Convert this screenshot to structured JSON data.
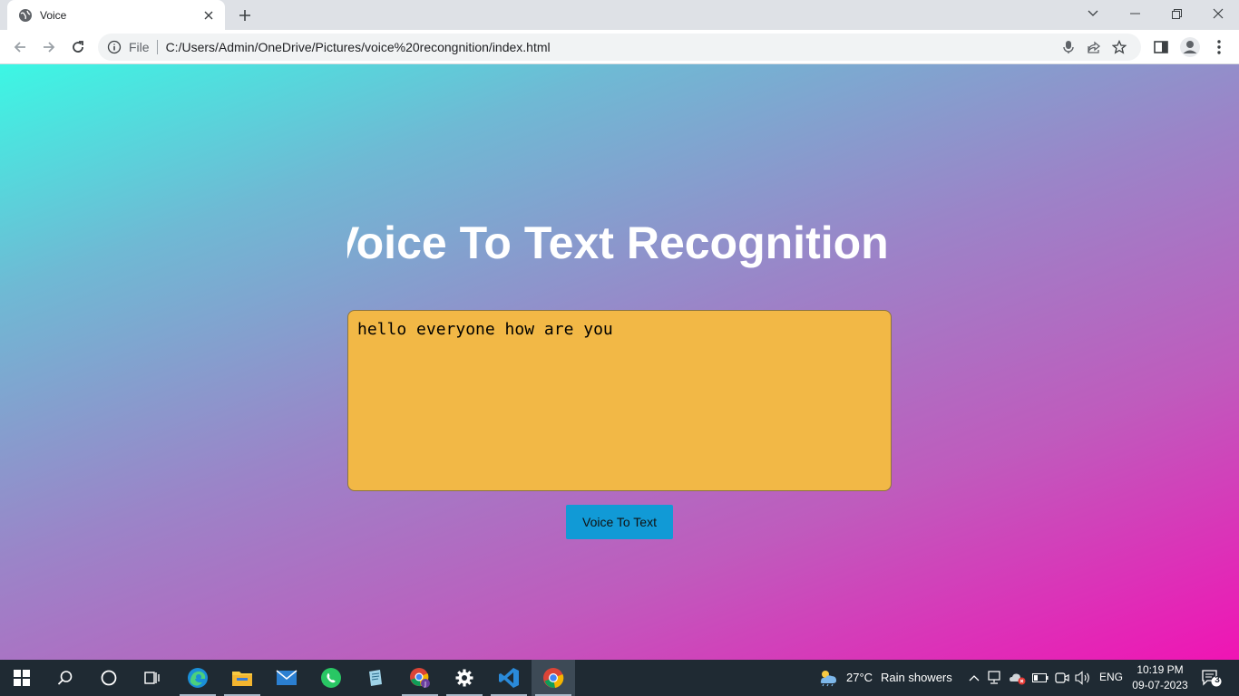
{
  "browser": {
    "tab": {
      "title": "Voice",
      "favicon": "globe-icon"
    },
    "address_bar": {
      "scheme_label": "File",
      "url": "C:/Users/Admin/OneDrive/Pictures/voice%20recongnition/index.html"
    }
  },
  "page": {
    "title": "Voice To Text Recognition",
    "textarea_value": "hello everyone how are you",
    "button_label": "Voice To Text",
    "colors": {
      "textarea_bg": "#f2b846",
      "button_bg": "#119ad6",
      "gradient_start": "#3cf7e4",
      "gradient_end": "#f014b4"
    }
  },
  "taskbar": {
    "apps": [
      "windows-start",
      "search",
      "cortana",
      "task-view",
      "edge",
      "file-explorer",
      "mail",
      "whatsapp",
      "notepad",
      "chrome-profile",
      "settings",
      "vscode",
      "chrome"
    ],
    "weather": {
      "temp": "27°C",
      "condition": "Rain showers"
    },
    "language": "ENG",
    "time": "10:19 PM",
    "date": "09-07-2023",
    "notification_count": "3"
  }
}
